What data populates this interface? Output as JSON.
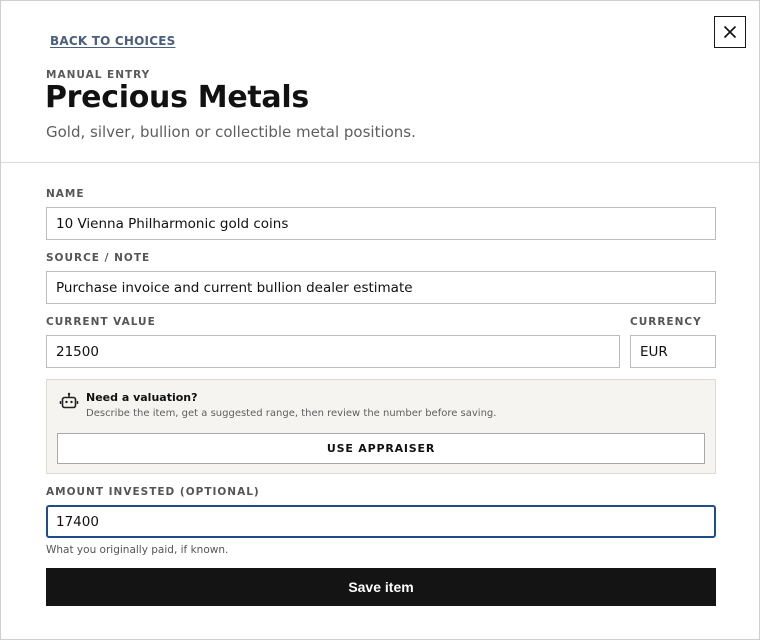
{
  "header": {
    "back_link": "BACK TO CHOICES",
    "eyebrow": "MANUAL ENTRY",
    "title": "Precious Metals",
    "subtitle": "Gold, silver, bullion or collectible metal positions."
  },
  "form": {
    "name": {
      "label": "NAME",
      "value": "10 Vienna Philharmonic gold coins"
    },
    "source": {
      "label": "SOURCE / NOTE",
      "value": "Purchase invoice and current bullion dealer estimate"
    },
    "current_value": {
      "label": "CURRENT VALUE",
      "value": "21500"
    },
    "currency": {
      "label": "CURRENCY",
      "value": "EUR"
    },
    "amount_invested": {
      "label": "AMOUNT INVESTED (OPTIONAL)",
      "value": "17400",
      "helper": "What you originally paid, if known."
    }
  },
  "valuation": {
    "icon": "robot-icon",
    "title": "Need a valuation?",
    "description": "Describe the item, get a suggested range, then review the number before saving.",
    "button_label": "USE APPRAISER"
  },
  "actions": {
    "save_label": "Save item",
    "close_icon": "close-icon"
  },
  "colors": {
    "link": "#4a5f7a",
    "focus": "#1f4d8c",
    "primary_button": "#141414",
    "panel": "#f5f4f0"
  }
}
